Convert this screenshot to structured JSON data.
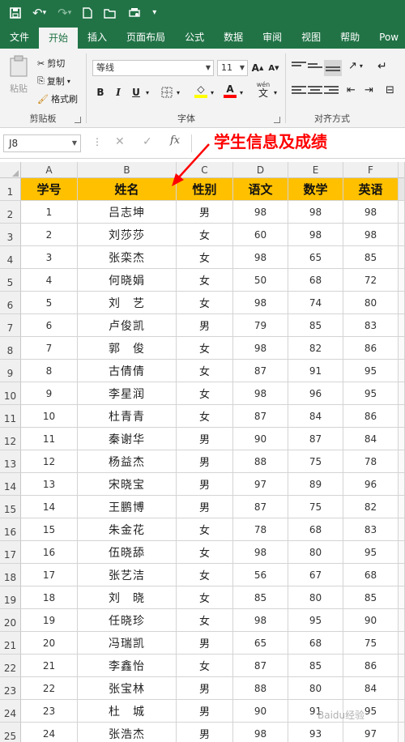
{
  "columns": [
    "A",
    "B",
    "C",
    "D",
    "E",
    "F"
  ],
  "tabs": [
    "文件",
    "开始",
    "插入",
    "页面布局",
    "公式",
    "数据",
    "审阅",
    "视图",
    "帮助",
    "Pow"
  ],
  "active_tab": "开始",
  "ribbon": {
    "clipboard": {
      "paste": "粘贴",
      "cut": "剪切",
      "copy": "复制",
      "format_painter": "格式刷",
      "label": "剪贴板"
    },
    "font": {
      "name": "等线",
      "size": "11",
      "grow": "A",
      "shrink": "A",
      "bold": "B",
      "italic": "I",
      "underline": "U",
      "font_color_letter": "A",
      "wen": "wén",
      "wen_char": "文",
      "label": "字体"
    },
    "alignment": {
      "label": "对齐方式"
    },
    "colors": {
      "fill_color": "#ffff00",
      "font_color": "#ff0000"
    }
  },
  "formula_bar": {
    "name_box": "J8",
    "fx": "fx",
    "value": ""
  },
  "annotation": {
    "text": "学生信息及成绩",
    "color": "#ff0000"
  },
  "header": [
    "学号",
    "姓名",
    "性别",
    "语文",
    "数学",
    "英语"
  ],
  "header_color": "#ffc000",
  "students": [
    [
      "1",
      "吕志坤",
      "男",
      "98",
      "98",
      "98"
    ],
    [
      "2",
      "刘莎莎",
      "女",
      "60",
      "98",
      "98"
    ],
    [
      "3",
      "张栾杰",
      "女",
      "98",
      "65",
      "85"
    ],
    [
      "4",
      "何晓娟",
      "女",
      "50",
      "68",
      "72"
    ],
    [
      "5",
      "刘　艺",
      "女",
      "98",
      "74",
      "80"
    ],
    [
      "6",
      "卢俊凯",
      "男",
      "79",
      "85",
      "83"
    ],
    [
      "7",
      "郭　俊",
      "女",
      "98",
      "82",
      "86"
    ],
    [
      "8",
      "古倩倩",
      "女",
      "87",
      "91",
      "95"
    ],
    [
      "9",
      "李星润",
      "女",
      "98",
      "96",
      "95"
    ],
    [
      "10",
      "杜青青",
      "女",
      "87",
      "84",
      "86"
    ],
    [
      "11",
      "秦谢华",
      "男",
      "90",
      "87",
      "84"
    ],
    [
      "12",
      "杨益杰",
      "男",
      "88",
      "75",
      "78"
    ],
    [
      "13",
      "宋晓宝",
      "男",
      "97",
      "89",
      "96"
    ],
    [
      "14",
      "王鹏博",
      "男",
      "87",
      "75",
      "82"
    ],
    [
      "15",
      "朱金花",
      "女",
      "78",
      "68",
      "83"
    ],
    [
      "16",
      "伍晓舔",
      "女",
      "98",
      "80",
      "95"
    ],
    [
      "17",
      "张艺洁",
      "女",
      "56",
      "67",
      "68"
    ],
    [
      "18",
      "刘　晓",
      "女",
      "85",
      "80",
      "85"
    ],
    [
      "19",
      "任晓珍",
      "女",
      "98",
      "95",
      "90"
    ],
    [
      "20",
      "冯瑞凯",
      "男",
      "65",
      "68",
      "75"
    ],
    [
      "21",
      "李鑫怡",
      "女",
      "87",
      "85",
      "86"
    ],
    [
      "22",
      "张宝林",
      "男",
      "88",
      "80",
      "84"
    ],
    [
      "23",
      "杜　城",
      "男",
      "90",
      "91",
      "95"
    ],
    [
      "24",
      "张浩杰",
      "男",
      "98",
      "93",
      "97"
    ]
  ],
  "row_numbers": [
    "1",
    "2",
    "3",
    "4",
    "5",
    "6",
    "7",
    "8",
    "9",
    "10",
    "11",
    "12",
    "13",
    "14",
    "15",
    "16",
    "17",
    "18",
    "19",
    "20",
    "21",
    "22",
    "23",
    "24",
    "25"
  ],
  "watermark": "Baidu经验"
}
